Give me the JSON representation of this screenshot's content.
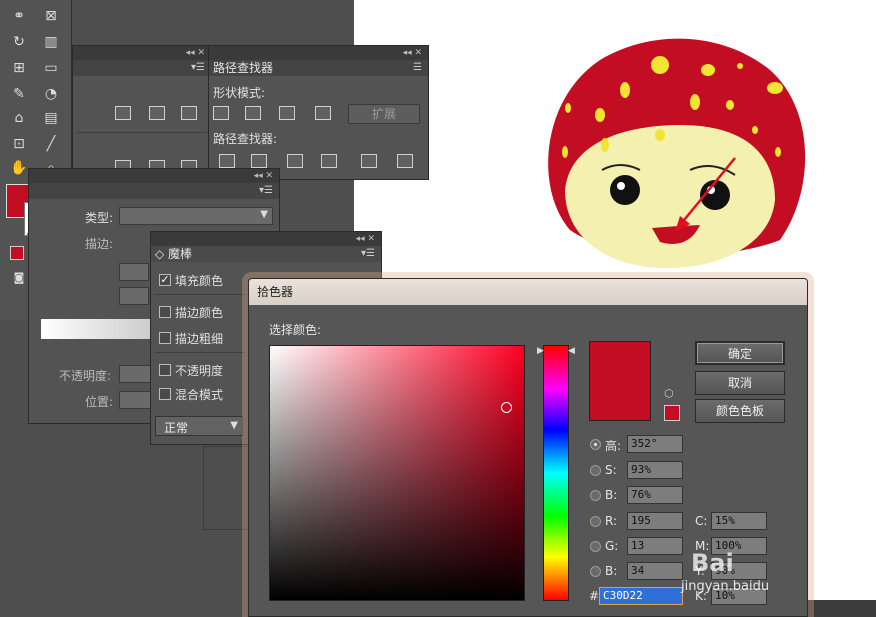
{
  "pathfinder": {
    "title": "路径查找器",
    "shape_modes_label": "形状模式:",
    "pathfinders_label": "路径查找器:",
    "expand_label": "扩展"
  },
  "appearance": {
    "type_label": "类型:",
    "stroke_label": "描边:",
    "opacity_label": "不透明度:",
    "position_label": "位置:"
  },
  "magic_wand": {
    "title": "魔棒",
    "options": [
      {
        "label": "填充颜色",
        "checked": true
      },
      {
        "label": "描边颜色",
        "checked": false
      },
      {
        "label": "描边粗细",
        "checked": false
      },
      {
        "label": "不透明度",
        "checked": false
      },
      {
        "label": "混合模式",
        "checked": false
      }
    ],
    "blend_mode": "正常"
  },
  "color_picker": {
    "title": "拾色器",
    "select_label": "选择颜色:",
    "ok_label": "确定",
    "cancel_label": "取消",
    "swatches_label": "颜色色板",
    "fields": {
      "H": {
        "label": "高:",
        "value": "352°"
      },
      "S": {
        "label": "S:",
        "value": "93%"
      },
      "Bv": {
        "label": "B:",
        "value": "76%"
      },
      "R": {
        "label": "R:",
        "value": "195"
      },
      "G": {
        "label": "G:",
        "value": "13"
      },
      "Bl": {
        "label": "B:",
        "value": "34"
      },
      "C": {
        "label": "C:",
        "value": "15%"
      },
      "M": {
        "label": "M:",
        "value": "100%"
      },
      "Y": {
        "label": "Y:",
        "value": "90%"
      },
      "K": {
        "label": "K:",
        "value": "10%"
      }
    },
    "hash_label": "#",
    "hex": "C30D22",
    "current_color": "#c30d22"
  },
  "watermark": "jingyan.baidu"
}
